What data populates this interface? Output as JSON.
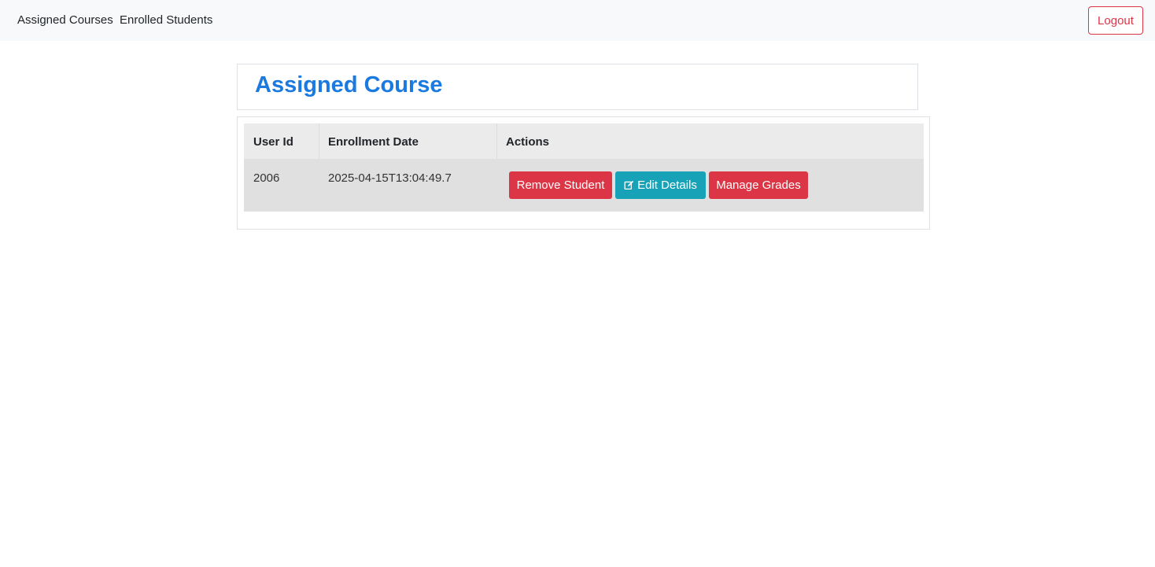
{
  "navbar": {
    "links": [
      "Assigned Courses",
      "Enrolled Students"
    ],
    "logout_label": "Logout"
  },
  "page": {
    "title": "Assigned Course"
  },
  "table": {
    "headers": [
      "User Id",
      "Enrollment Date",
      "Actions"
    ],
    "rows": [
      {
        "user_id": "2006",
        "enrollment_date": "2025-04-15T13:04:49.7",
        "actions": {
          "remove_label": "Remove Student",
          "edit_label": "Edit Details",
          "grades_label": "Manage Grades"
        }
      }
    ]
  },
  "icons": {
    "edit": "edit-icon"
  },
  "colors": {
    "danger": "#dc3545",
    "info": "#17a2b8",
    "title": "#1a7ae0",
    "navbar_bg": "#f8f9fa"
  }
}
